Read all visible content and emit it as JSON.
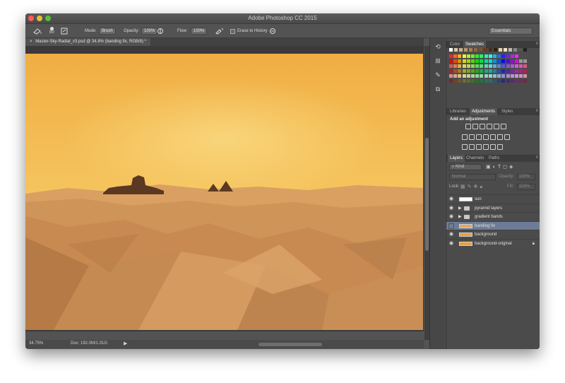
{
  "window": {
    "title": "Adobe Photoshop CC 2015"
  },
  "options_bar": {
    "brush_size": "80",
    "mode_label": "Mode:",
    "mode_value": "Brush",
    "opacity_label": "Opacity:",
    "opacity_value": "100%",
    "flow_label": "Flow:",
    "flow_value": "100%",
    "erase_history_label": "Erase to History",
    "workspace": "Essentials"
  },
  "document": {
    "tab_label": "Master-Sky-Radial_v3.psd @ 34.8% (banding fix, RGB/8) *",
    "zoom": "34.75%",
    "doc_size": "Doc: 192.0M/1.01G"
  },
  "color_panel": {
    "tabs": [
      "Color",
      "Swatches"
    ],
    "active_tab": "Swatches"
  },
  "adjustments_panel": {
    "tabs": [
      "Libraries",
      "Adjustments",
      "Styles"
    ],
    "active_tab": "Adjustments",
    "heading": "Add an adjustment"
  },
  "layers_panel": {
    "tabs": [
      "Layers",
      "Channels",
      "Paths"
    ],
    "active_tab": "Layers",
    "filter_kind": "Kind",
    "blend_mode": "Normal",
    "opacity_label": "Opacity:",
    "opacity_value": "100%",
    "lock_label": "Lock:",
    "fill_label": "Fill:",
    "fill_value": "100%",
    "layers": [
      {
        "name": "sun",
        "type": "layer",
        "visible": true,
        "thumb": "#ffffff"
      },
      {
        "name": "pyramid layers",
        "type": "group",
        "visible": true
      },
      {
        "name": "gradient bands",
        "type": "group",
        "visible": true
      },
      {
        "name": "banding fix",
        "type": "layer",
        "visible": false,
        "selected": true,
        "thumb": "#e0a860"
      },
      {
        "name": "background",
        "type": "layer",
        "visible": true,
        "thumb": "#e8a040"
      },
      {
        "name": "background-original",
        "type": "layer",
        "visible": true,
        "thumb": "#e8a040",
        "locked": true
      }
    ]
  },
  "colors": {
    "sky_top": "#f2b548",
    "sky_bottom": "#f7cf6a",
    "sand": "#c98850",
    "selection": "#6d7c96"
  }
}
